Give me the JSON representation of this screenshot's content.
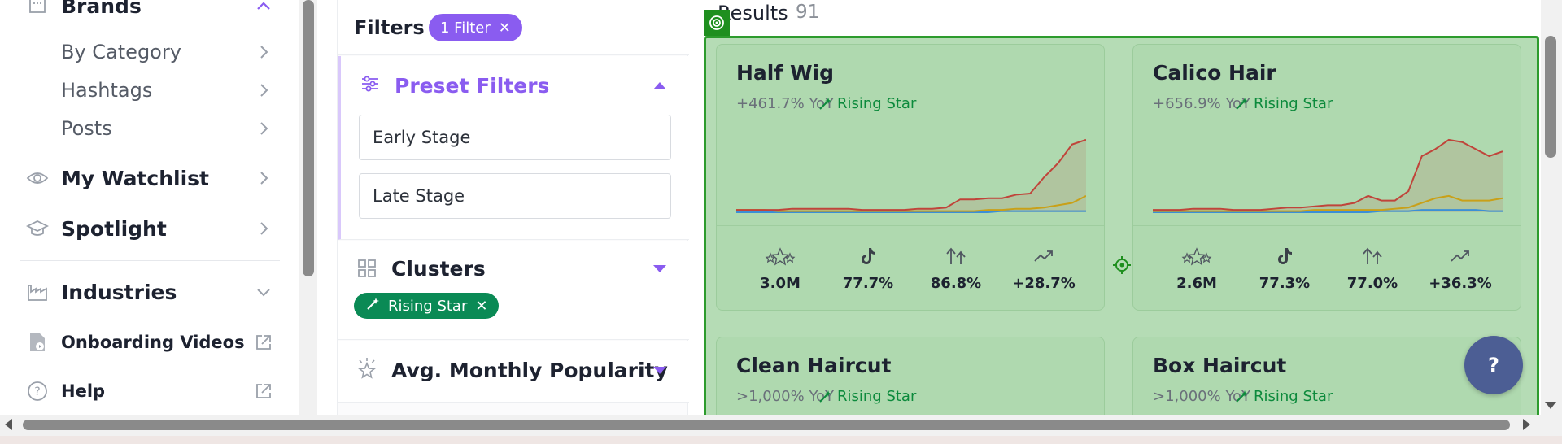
{
  "sidebar": {
    "brands_label": "Brands",
    "by_category": "By Category",
    "hashtags": "Hashtags",
    "posts": "Posts",
    "watchlist": "My Watchlist",
    "spotlight": "Spotlight",
    "industries": "Industries",
    "onboarding": "Onboarding Videos",
    "help": "Help"
  },
  "filters": {
    "title": "Filters",
    "active_chip": "1 Filter",
    "preset": {
      "label": "Preset Filters",
      "options": [
        "Early Stage",
        "Late Stage"
      ]
    },
    "clusters": {
      "label": "Clusters",
      "chip": "Rising Star"
    },
    "popularity": {
      "label": "Avg. Monthly Popularity"
    }
  },
  "results": {
    "title": "Results",
    "count": "91",
    "cards": [
      {
        "name": "Half Wig",
        "yoy": "+461.7% YoY",
        "badge": "Rising Star",
        "stats": [
          "3.0M",
          "77.7%",
          "86.8%",
          "+28.7%"
        ],
        "red": [
          2,
          2,
          2,
          2,
          3,
          3,
          3,
          3,
          3,
          2,
          2,
          2,
          2,
          3,
          3,
          4,
          11,
          11,
          12,
          12,
          15,
          16,
          30,
          42,
          58,
          62
        ],
        "gold": [
          2,
          2,
          2,
          1,
          1,
          1,
          1,
          1,
          1,
          1,
          1,
          1,
          1,
          1,
          1,
          1,
          1,
          1,
          2,
          2,
          3,
          3,
          4,
          6,
          8,
          14
        ],
        "blue": [
          0,
          0,
          0,
          0,
          0,
          0,
          0,
          0,
          0,
          0,
          0,
          0,
          0,
          0,
          0,
          0,
          0,
          0,
          0,
          1,
          1,
          1,
          1,
          1,
          1,
          1
        ]
      },
      {
        "name": "Calico Hair",
        "yoy": "+656.9% YoY",
        "badge": "Rising Star",
        "stats": [
          "2.6M",
          "77.3%",
          "77.0%",
          "+36.3%"
        ],
        "red": [
          2,
          2,
          2,
          3,
          3,
          3,
          2,
          2,
          2,
          3,
          4,
          4,
          5,
          6,
          6,
          8,
          14,
          10,
          10,
          18,
          48,
          54,
          62,
          60,
          54,
          48,
          52
        ],
        "gold": [
          1,
          1,
          1,
          1,
          1,
          1,
          1,
          1,
          1,
          1,
          1,
          1,
          2,
          2,
          2,
          2,
          2,
          2,
          3,
          4,
          8,
          12,
          14,
          10,
          10,
          10,
          12
        ],
        "blue": [
          0,
          0,
          0,
          0,
          0,
          0,
          0,
          0,
          0,
          0,
          0,
          0,
          0,
          0,
          0,
          0,
          0,
          1,
          1,
          1,
          2,
          2,
          2,
          2,
          2,
          1,
          1
        ]
      },
      {
        "name": "Clean Haircut",
        "yoy": ">1,000% YoY",
        "badge": "Rising Star"
      },
      {
        "name": "Box Haircut",
        "yoy": ">1,000% YoY",
        "badge": "Rising Star"
      }
    ]
  },
  "help_button": "?",
  "colors": {
    "accent": "#8a5cf0",
    "rising_star": "#0a8a55",
    "overlay": "#b5dcb5"
  }
}
